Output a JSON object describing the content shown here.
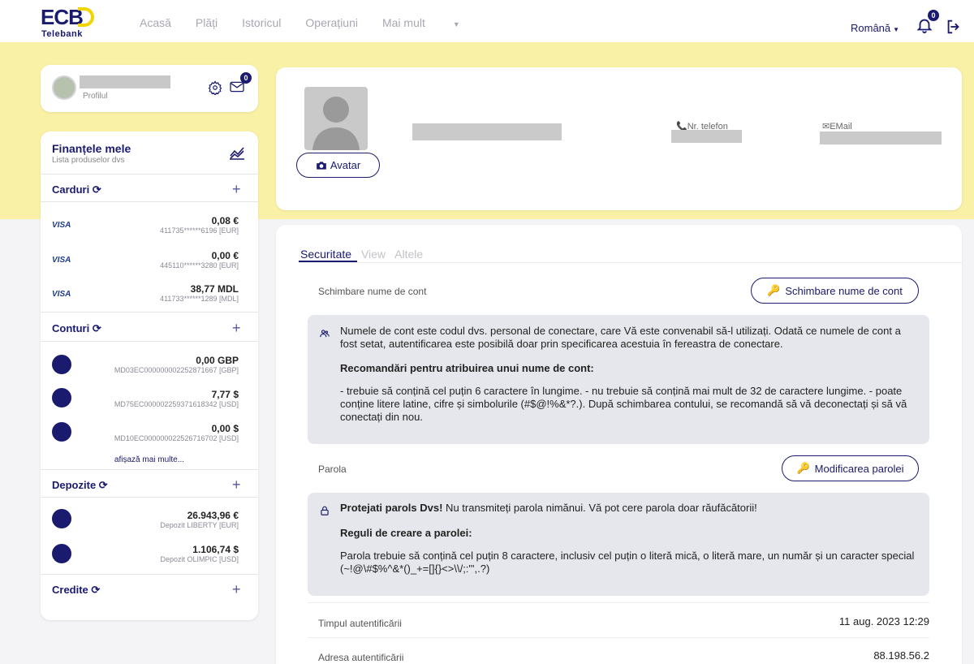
{
  "brand": {
    "name": "ECB",
    "subtitle": "Telebank"
  },
  "nav": {
    "items": [
      "Acasă",
      "Plăți",
      "Istoricul",
      "Operațiuni",
      "Mai mult"
    ],
    "language": "Română",
    "notification_count": "0"
  },
  "profile_card": {
    "label": "Profilul",
    "messages_count": "0"
  },
  "finances": {
    "title": "Finanțele mele",
    "subtitle": "Lista produselor dvs",
    "cards_label": "Carduri",
    "cards": [
      {
        "brand": "VISA",
        "amount": "0,08 €",
        "number": "411735******6196 [EUR]"
      },
      {
        "brand": "VISA",
        "amount": "0,00 €",
        "number": "445110******3280 [EUR]"
      },
      {
        "brand": "VISA",
        "amount": "38,77 MDL",
        "number": "411733******1289 [MDL]"
      }
    ],
    "accounts_label": "Conturi",
    "accounts": [
      {
        "amount": "0,00 GBP",
        "iban": "MD03EC000000002252871667 [GBP]"
      },
      {
        "amount": "7,77 $",
        "iban": "MD75EC000002259371618342 [USD]"
      },
      {
        "amount": "0,00 $",
        "iban": "MD10EC000000022526716702 [USD]"
      }
    ],
    "show_more": "afișază mai multe...",
    "deposits_label": "Depozite",
    "deposits": [
      {
        "amount": "26.943,96 €",
        "name": "Depozit LIBERTY [EUR]"
      },
      {
        "amount": "1.106,74 $",
        "name": "Depozit OLIMPIC [USD]"
      }
    ],
    "credits_label": "Credite"
  },
  "profile_main": {
    "avatar_button": "Avatar",
    "phone_label": "Nr. telefon",
    "email_label": "EMail"
  },
  "settings": {
    "tabs": [
      "Securitate",
      "View",
      "Altele"
    ],
    "username_row_label": "Schimbare nume de cont",
    "username_button": "Schimbare nume de cont",
    "username_info": "Numele de cont este codul dvs. personal de conectare, care Vă este convenabil să-l utilizați. Odată ce numele de cont a fost setat, autentificarea este posibilă doar prin specificarea acestuia în fereastra de conectare.",
    "username_reco_title": "Recomandări pentru atribuirea unui nume de cont:",
    "username_reco_text": "- trebuie să conțină cel puțin 6 caractere în lungime. - nu trebuie să conțină mai mult de 32 de caractere lungime. - poate conține litere latine, cifre și simbolurile (#$@!%&*?.). După schimbarea contului, se recomandă să vă deconectați și să vă conectați din nou.",
    "password_row_label": "Parola",
    "password_button": "Modificarea parolei",
    "password_warning_bold": "Protejati parols Dvs!",
    "password_warning_text": " Nu transmiteți parola nimănui. Vă pot cere parola doar răufăcătorii!",
    "password_rules_title": "Reguli de creare a parolei:",
    "password_rules_text": "Parola trebuie să conțină cel puțin 8 caractere, inclusiv cel puțin o literă mică, o literă mare, un număr și un caracter special (~!@\\#$%^&*()_+=[]{}<>\\\\/;:\"',.?)",
    "auth_time_label": "Timpul autentificării",
    "auth_time_value": "11 aug. 2023 12:29",
    "auth_address_label": "Adresa autentificării",
    "auth_address_value": "88.198.56.2"
  },
  "colors": {
    "brand_navy": "#1a1a6e",
    "brand_yellow": "#f2d500",
    "band_yellow": "#f9f1a5",
    "info_gray": "#e6e7ec"
  }
}
